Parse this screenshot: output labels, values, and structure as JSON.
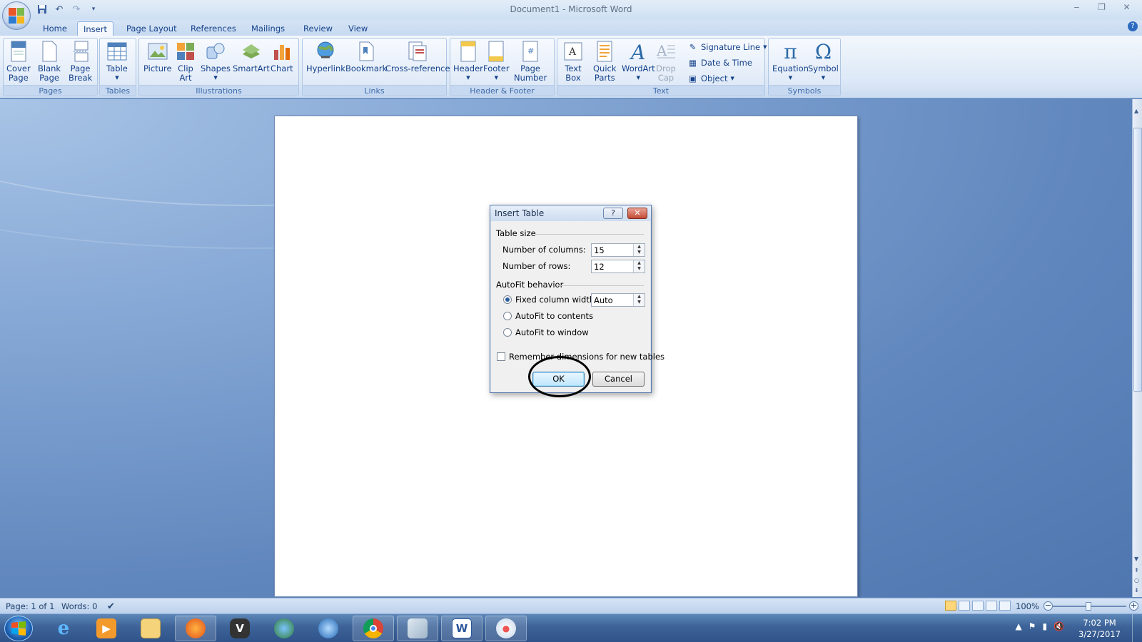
{
  "window": {
    "title": "Document1 - Microsoft Word",
    "minimize": "‒",
    "maximize": "❐",
    "close": "✕"
  },
  "tabs": [
    "Home",
    "Insert",
    "Page Layout",
    "References",
    "Mailings",
    "Review",
    "View"
  ],
  "active_tab": "Insert",
  "ribbon": {
    "pages": {
      "label": "Pages",
      "cover_page": "Cover",
      "cover_page2": "Page",
      "blank_page": "Blank",
      "blank_page2": "Page",
      "page_break": "Page",
      "page_break2": "Break"
    },
    "tables": {
      "label": "Tables",
      "table": "Table"
    },
    "illustrations": {
      "label": "Illustrations",
      "picture": "Picture",
      "clip_art": "Clip",
      "clip_art2": "Art",
      "shapes": "Shapes",
      "smartart": "SmartArt",
      "chart": "Chart"
    },
    "links": {
      "label": "Links",
      "hyperlink": "Hyperlink",
      "bookmark": "Bookmark",
      "cross_reference": "Cross-reference"
    },
    "header_footer": {
      "label": "Header & Footer",
      "header": "Header",
      "footer": "Footer",
      "page_number": "Page",
      "page_number2": "Number"
    },
    "text": {
      "label": "Text",
      "text_box": "Text",
      "text_box2": "Box",
      "quick_parts": "Quick",
      "quick_parts2": "Parts",
      "wordart": "WordArt",
      "drop_cap": "Drop",
      "drop_cap2": "Cap",
      "signature_line": "Signature Line",
      "date_time": "Date & Time",
      "object": "Object"
    },
    "symbols": {
      "label": "Symbols",
      "equation": "Equation",
      "symbol": "Symbol"
    }
  },
  "dialog": {
    "title": "Insert Table",
    "help": "?",
    "close": "✕",
    "table_size_label": "Table size",
    "columns_label": "Number of columns:",
    "columns_value": "15",
    "rows_label": "Number of rows:",
    "rows_value": "12",
    "autofit_label": "AutoFit behavior",
    "fixed_width_label": "Fixed column width:",
    "fixed_width_value": "Auto",
    "autofit_contents_label": "AutoFit to contents",
    "autofit_window_label": "AutoFit to window",
    "remember_label": "Remember dimensions for new tables",
    "ok_label": "OK",
    "cancel_label": "Cancel"
  },
  "status": {
    "page": "Page: 1 of 1",
    "words": "Words: 0",
    "zoom": "100%"
  },
  "taskbar": {
    "time": "7:02 PM",
    "date": "3/27/2017"
  },
  "colors": {
    "ribbon_text": "#15428b",
    "accent": "#2b5d9e",
    "annotation": "#000000"
  }
}
